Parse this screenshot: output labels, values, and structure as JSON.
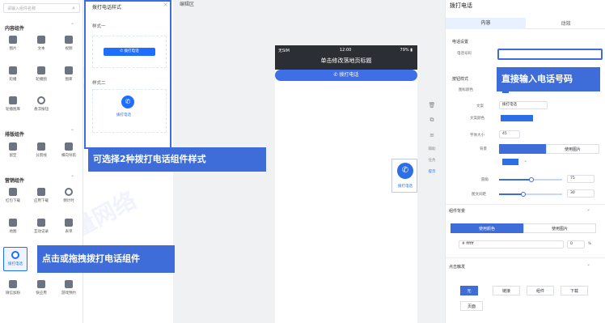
{
  "left_panel": {
    "search_placeholder": "请输入组件名称",
    "sections": [
      {
        "title": "内容组件",
        "items": [
          "图片",
          "文本",
          "视频",
          "轮播",
          "轮播图",
          "图库",
          "轮播图库",
          "悬浮按钮"
        ]
      },
      {
        "title": "排版组件",
        "items": [
          "留空",
          "分割线",
          "横向导航"
        ]
      },
      {
        "title": "营销组件",
        "items": [
          "红包下载",
          "应用下载",
          "倒计时",
          "地图",
          "互动记录",
          "表单",
          "拨打电话",
          "微信加粉",
          "快应用",
          "游戏预约"
        ]
      }
    ]
  },
  "style_panel": {
    "title": "拨打电话样式",
    "style1": "样式一",
    "style2": "样式二",
    "button_text": "拨打电话",
    "circle_label": "拨打电话"
  },
  "canvas": {
    "title": "编辑区",
    "sim": "无SIM",
    "time": "12:00",
    "battery": "79%",
    "page_title": "单击修改落地页标题",
    "call_bar_text": "拨打电话",
    "float_label": "拨打电话",
    "side_labels": [
      "辅助",
      "任务",
      "提示"
    ]
  },
  "right_panel": {
    "title": "拨打电话",
    "tabs": [
      "内容",
      "动效"
    ],
    "phone_settings": "电话设置",
    "phone_label": "电话号码",
    "phone_value": "",
    "button_style": "按钮样式",
    "icon_color": "图标颜色",
    "text_label": "文案",
    "text_value": "拨打电话",
    "text_color": "文案颜色",
    "font_size_label": "字体大小",
    "font_size": "45",
    "bg_label": "背景",
    "use_image": "使用图片",
    "radius_label": "圆角",
    "radius_value": "75",
    "spacing_label": "图文间距",
    "spacing_value": "30",
    "component_bg": "组件背景",
    "use_color": "使用颜色",
    "use_image_2": "使用图片",
    "color_hex": "ffffff",
    "opacity": "0",
    "percent": "%",
    "click_trigger": "点击触发",
    "trigger_options": [
      "无",
      "链接",
      "组件",
      "下载",
      "页面"
    ]
  },
  "callouts": {
    "style": "可选择2种拨打电话组件样式",
    "drag": "点击或拖拽拨打电话组件",
    "phone": "直接输入电话号码"
  },
  "colors": {
    "accent": "#3e6cd9",
    "brand_blue": "#1e6fff",
    "phone_bar": "#2b2f33"
  },
  "watermark": "巨量网络"
}
